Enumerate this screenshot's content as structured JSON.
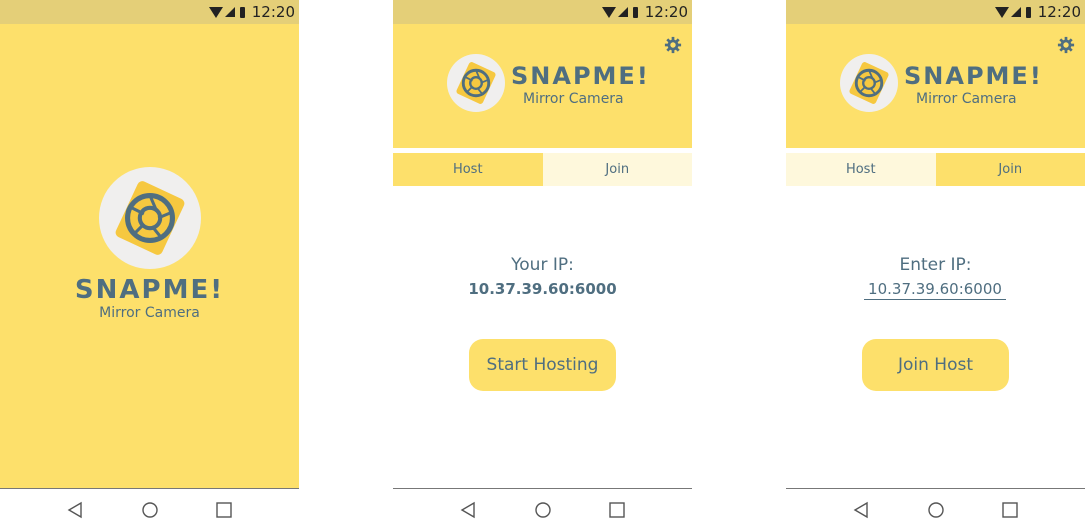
{
  "status": {
    "time": "12:20"
  },
  "brand": {
    "name": "SNAPME!",
    "tagline": "Mirror Camera"
  },
  "tabs": {
    "host": "Host",
    "join": "Join"
  },
  "host_screen": {
    "ip_label": "Your IP:",
    "ip_value": "10.37.39.60:6000",
    "button": "Start Hosting"
  },
  "join_screen": {
    "ip_label": "Enter IP:",
    "ip_value": "10.37.39.60:6000",
    "button": "Join Host"
  },
  "colors": {
    "accent": "#fde06b",
    "status_bar": "#e4cf78",
    "text": "#4f6e80",
    "tab_inactive": "#fef8dc",
    "logo_bg": "#f0efee",
    "logo_diamond": "#f6c840"
  }
}
